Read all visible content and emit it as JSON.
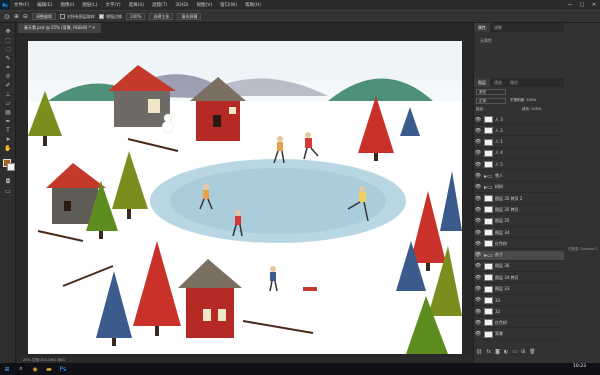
{
  "app": {
    "logo": "Ps"
  },
  "menu": [
    "文件(F)",
    "编辑(E)",
    "图像(I)",
    "图层(L)",
    "文字(Y)",
    "选择(S)",
    "滤镜(T)",
    "3D(D)",
    "视图(V)",
    "窗口(W)",
    "帮助(H)"
  ],
  "window_controls": [
    "—",
    "□",
    "✕"
  ],
  "options": {
    "chip1": "调整编辑",
    "check1": "对所有图层取样",
    "check2": "增强边缘",
    "chip2": "100%",
    "chip3": "选择主体",
    "chip4": "填充屏幕"
  },
  "document_tab": "春天素.psd @ 25% (背景, RGB/8) *  ✕",
  "status_text": "25%  文档:100.1M/1.60G",
  "panels": {
    "top_tabs": [
      "属性",
      "调整"
    ],
    "prop_label": "无属性",
    "layer_tabs": [
      "图层",
      "通道",
      "路径"
    ],
    "kind_label": "类型",
    "blend_mode": "正常",
    "opacity_label": "不透明度: 100%",
    "fill_label": "填充: 100%",
    "lock_label": "锁定:",
    "side_text": "已登录 Creative C"
  },
  "layers": [
    {
      "name": "人 3",
      "type": "layer",
      "selected": false
    },
    {
      "name": "人 2",
      "type": "layer",
      "selected": false
    },
    {
      "name": "人 1",
      "type": "layer",
      "selected": false
    },
    {
      "name": "人 4",
      "type": "layer",
      "selected": false
    },
    {
      "name": "人 5",
      "type": "layer",
      "selected": false
    },
    {
      "name": "雪人",
      "type": "folder",
      "selected": false
    },
    {
      "name": "树树",
      "type": "folder",
      "selected": false
    },
    {
      "name": "图层 35 拷贝 2",
      "type": "layer",
      "selected": false
    },
    {
      "name": "图层 35 拷贝",
      "type": "layer",
      "selected": false
    },
    {
      "name": "图层 35",
      "type": "layer",
      "selected": false
    },
    {
      "name": "图层 34",
      "type": "layer",
      "selected": false
    },
    {
      "name": "红色树",
      "type": "layer",
      "selected": false
    },
    {
      "name": "房子",
      "type": "folder",
      "selected": true
    },
    {
      "name": "图层 36",
      "type": "layer",
      "selected": false
    },
    {
      "name": "图层 34 拷贝",
      "type": "layer",
      "selected": false
    },
    {
      "name": "图层 33",
      "type": "layer",
      "selected": false
    },
    {
      "name": "33",
      "type": "layer",
      "selected": false
    },
    {
      "name": "32",
      "type": "layer",
      "selected": false
    },
    {
      "name": "红色树",
      "type": "layer",
      "selected": false
    },
    {
      "name": "背景",
      "type": "layer",
      "selected": false
    }
  ],
  "taskbar": {
    "time": "10:23"
  },
  "colors": {
    "foreground": "#a4651e",
    "background": "#f4f4f4",
    "accent": "#31a8ff"
  },
  "icons": [
    "move-icon",
    "marquee-icon",
    "lasso-icon",
    "quick-select-icon",
    "crop-icon",
    "eyedropper-icon",
    "brush-icon",
    "stamp-icon",
    "eraser-icon",
    "gradient-icon",
    "dodge-icon",
    "pen-icon",
    "text-icon",
    "path-select-icon",
    "shape-icon",
    "hand-icon",
    "zoom-icon"
  ]
}
